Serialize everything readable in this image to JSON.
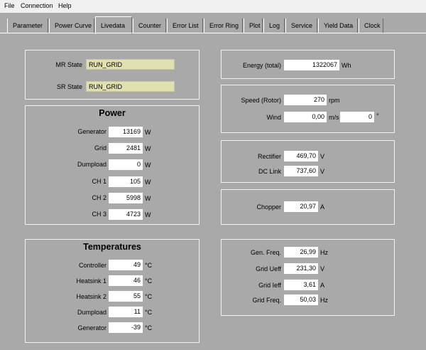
{
  "menu": {
    "file": "File",
    "connection": "Connection",
    "help": "Help"
  },
  "tabs": [
    "Parameter",
    "Power Curve",
    "Livedata",
    "Counter",
    "Error List",
    "Error Ring",
    "Plot",
    "Log",
    "Service",
    "Yield Data",
    "Clock"
  ],
  "active_tab": "Livedata",
  "state": {
    "mr_label": "MR State",
    "mr_value": "RUN_GRID",
    "sr_label": "SR State",
    "sr_value": "RUN_GRID"
  },
  "power": {
    "title": "Power",
    "generator": {
      "label": "Generator",
      "value": "13169",
      "unit": "W"
    },
    "grid": {
      "label": "Grid",
      "value": "2481",
      "unit": "W"
    },
    "dumpload": {
      "label": "Dumpload",
      "value": "0",
      "unit": "W"
    },
    "ch1": {
      "label": "CH 1",
      "value": "105",
      "unit": "W"
    },
    "ch2": {
      "label": "CH 2",
      "value": "5998",
      "unit": "W"
    },
    "ch3": {
      "label": "CH 3",
      "value": "4723",
      "unit": "W"
    }
  },
  "temperatures": {
    "title": "Temperatures",
    "controller": {
      "label": "Controller",
      "value": "49",
      "unit": "°C"
    },
    "heatsink1": {
      "label": "Heatsink 1",
      "value": "46",
      "unit": "°C"
    },
    "heatsink2": {
      "label": "Heatsink 2",
      "value": "55",
      "unit": "°C"
    },
    "dumpload": {
      "label": "Dumpload",
      "value": "11",
      "unit": "°C"
    },
    "generator": {
      "label": "Generator",
      "value": "-39",
      "unit": "°C"
    }
  },
  "energy": {
    "label": "Energy (total)",
    "value": "1322067",
    "unit": "Wh"
  },
  "speed": {
    "rotor_label": "Speed (Rotor)",
    "rotor_value": "270",
    "rotor_unit": "rpm",
    "wind_label": "Wind",
    "wind_value": "0,00",
    "wind_unit": "m/s",
    "dir_value": "0",
    "dir_unit": "°"
  },
  "dc": {
    "rectifier": {
      "label": "Rectifier",
      "value": "469,70",
      "unit": "V"
    },
    "dclink": {
      "label": "DC Link",
      "value": "737,60",
      "unit": "V"
    }
  },
  "chopper": {
    "label": "Chopper",
    "value": "20,97",
    "unit": "A"
  },
  "grid": {
    "freq_gen": {
      "label": "Gen. Freq.",
      "value": "26,99",
      "unit": "Hz"
    },
    "ueff": {
      "label": "Grid Ueff",
      "value": "231,30",
      "unit": "V"
    },
    "ieff": {
      "label": "Grid Ieff",
      "value": "3,61",
      "unit": "A"
    },
    "freq": {
      "label": "Grid Freq.",
      "value": "50,03",
      "unit": "Hz"
    }
  }
}
